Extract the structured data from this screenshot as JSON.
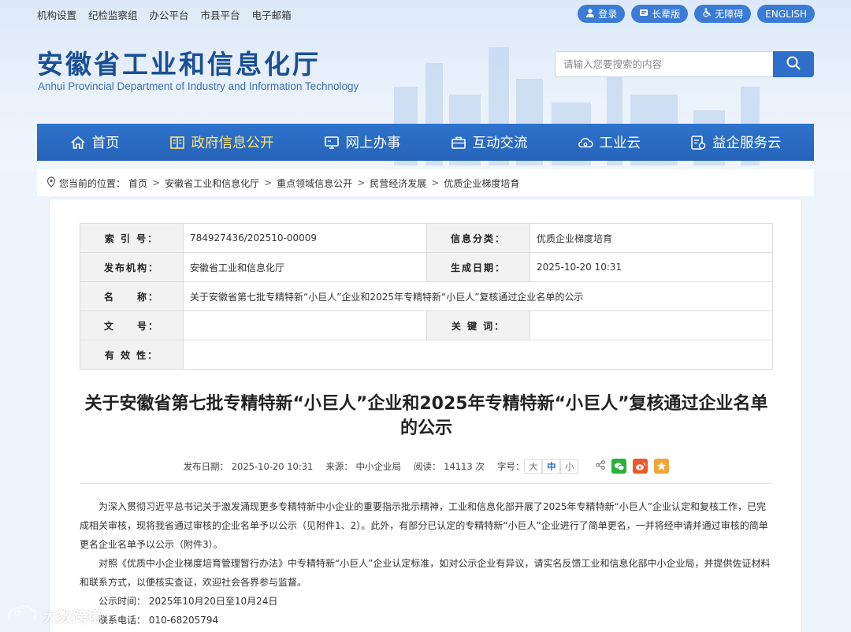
{
  "toplinks": [
    "机构设置",
    "纪检监察组",
    "办公平台",
    "市县平台",
    "电子邮箱"
  ],
  "topbuttons": {
    "login": "登录",
    "elder": "长辈版",
    "accessible": "无障碍",
    "english": "ENGLISH"
  },
  "site": {
    "title": "安徽省工业和信息化厅",
    "subtitle": "Anhui Provincial Department of Industry and Information Technology"
  },
  "search": {
    "placeholder": "请输入您要搜索的内容"
  },
  "nav": [
    {
      "label": "首页",
      "icon": "home-icon"
    },
    {
      "label": "政府信息公开",
      "icon": "book-icon",
      "active": true
    },
    {
      "label": "网上办事",
      "icon": "monitor-icon"
    },
    {
      "label": "互动交流",
      "icon": "briefcase-icon"
    },
    {
      "label": "工业云",
      "icon": "cloud-icon"
    },
    {
      "label": "益企服务云",
      "icon": "service-icon"
    }
  ],
  "breadcrumb": {
    "prefix": "您当前的位置：",
    "items": [
      "首页",
      "安徽省工业和信息化厅",
      "重点领域信息公开",
      "民营经济发展",
      "优质企业梯度培育"
    ]
  },
  "meta": {
    "index_label": "索 引 号：",
    "index_value": "784927436/202510-00009",
    "category_label": "信息分类：",
    "category_value": "优质企业梯度培育",
    "publisher_label": "发布机构：",
    "publisher_value": "安徽省工业和信息化厅",
    "date_label": "生成日期：",
    "date_value": "2025-10-20 10:31",
    "name_label": "名　　称：",
    "name_value": "关于安徽省第七批专精特新“小巨人”企业和2025年专精特新“小巨人”复核通过企业名单的公示",
    "docno_label": "文　　号：",
    "docno_value": "",
    "keywords_label": "关 键 词：",
    "keywords_value": "",
    "validity_label": "有 效 性：",
    "validity_value": ""
  },
  "article": {
    "title": "关于安徽省第七批专精特新“小巨人”企业和2025年专精特新“小巨人”复核通过企业名单的公示",
    "publish": "发布日期：  2025-10-20 10:31",
    "source": "来源：  中小企业局",
    "reads": "阅读：  14113 次",
    "fontsize_label": "字号：",
    "fs_large": "大",
    "fs_medium": "中",
    "fs_small": "小",
    "p1": "为深入贯彻习近平总书记关于激发涌现更多专精特新中小企业的重要指示批示精神，工业和信息化部开展了2025年专精特新“小巨人”企业认定和复核工作，已完成相关审核，现将我省通过审核的企业名单予以公示（见附件1、2）。此外，有部分已认定的专精特新“小巨人”企业进行了简单更名，一并将经申请并通过审核的简单更名企业名单予以公示（附件3）。",
    "p2": "对照《优质中小企业梯度培育管理暂行办法》中专精特新“小巨人”企业认定标准，如对公示企业有异议，请实名反馈工业和信息化部中小企业局，并提供佐证材料和联系方式，以便核实查证，欢迎社会各界参与监督。",
    "p3": "公示时间：  2025年10月20日至10月24日",
    "p4": "联系电话：  010-68205794"
  },
  "watermark": "大数跨境",
  "colors": {
    "brand": "#2563b8",
    "active_nav": "#ffe27a",
    "pill": "#3a7bd5"
  }
}
